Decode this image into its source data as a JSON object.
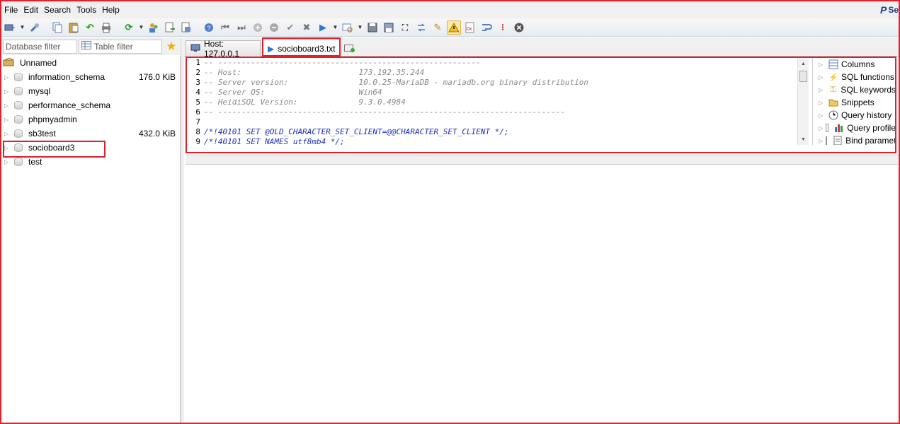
{
  "menu": [
    "File",
    "Edit",
    "Search",
    "Tools",
    "Help"
  ],
  "brand": {
    "mark": "P",
    "text": "Se"
  },
  "toolbar": {
    "icons": [
      "connect-icon",
      "connect-dropdown",
      "plug-icon",
      "copy-icon",
      "paste-icon",
      "undo-icon",
      "print-icon",
      "refresh-icon",
      "refresh-dropdown",
      "users-icon",
      "export-icon",
      "import-icon",
      "help-icon",
      "first-icon",
      "last-icon",
      "add-icon",
      "remove-icon",
      "apply-icon",
      "cancel-icon",
      "run-icon",
      "run-dropdown",
      "query-icon",
      "query-dropdown",
      "save-icon",
      "saveas-icon",
      "binoculars-icon",
      "replace-icon",
      "edit-icon",
      "warning-icon",
      "hex-icon",
      "wrap-icon",
      "stop-icon",
      "close-icon"
    ]
  },
  "filters": {
    "database_filter_placeholder": "Database filter",
    "table_filter_placeholder": "Table filter"
  },
  "tree": {
    "root": "Unnamed",
    "databases": [
      {
        "name": "information_schema",
        "size": "176.0 KiB"
      },
      {
        "name": "mysql",
        "size": ""
      },
      {
        "name": "performance_schema",
        "size": ""
      },
      {
        "name": "phpmyadmin",
        "size": ""
      },
      {
        "name": "sb3test",
        "size": "432.0 KiB"
      },
      {
        "name": "socioboard3",
        "size": ""
      },
      {
        "name": "test",
        "size": ""
      }
    ]
  },
  "tabs": {
    "host": "Host: 127.0.0.1",
    "file": "socioboard3.txt"
  },
  "editor": {
    "lines": [
      {
        "n": "1",
        "text": "-- --------------------------------------------------------",
        "kind": "comment"
      },
      {
        "n": "2",
        "text": "-- Host:                         173.192.35.244",
        "kind": "comment"
      },
      {
        "n": "3",
        "text": "-- Server version:               10.0.25-MariaDB - mariadb.org binary distribution",
        "kind": "comment"
      },
      {
        "n": "4",
        "text": "-- Server OS:                    Win64",
        "kind": "comment"
      },
      {
        "n": "5",
        "text": "-- HeidiSQL Version:             9.3.0.4984",
        "kind": "comment"
      },
      {
        "n": "6",
        "text": "-- --------------------------------------------------------------------------",
        "kind": "comment"
      },
      {
        "n": "7",
        "text": "",
        "kind": "comment"
      },
      {
        "n": "8",
        "text": "/*!40101 SET @OLD_CHARACTER_SET_CLIENT=@@CHARACTER_SET_CLIENT */;",
        "kind": "directive"
      },
      {
        "n": "9",
        "text": "/*!40101 SET NAMES utf8mb4 */;",
        "kind": "directive"
      }
    ]
  },
  "helpers": [
    {
      "label": "Columns",
      "icon": "columns-icon",
      "checkbox": false
    },
    {
      "label": "SQL functions",
      "icon": "lightning-icon",
      "checkbox": false
    },
    {
      "label": "SQL keywords",
      "icon": "key-icon",
      "checkbox": false
    },
    {
      "label": "Snippets",
      "icon": "folder-icon",
      "checkbox": false
    },
    {
      "label": "Query history",
      "icon": "clock-icon",
      "checkbox": false
    },
    {
      "label": "Query profile",
      "icon": "chart-icon",
      "checkbox": true
    },
    {
      "label": "Bind parameters",
      "icon": "bind-icon",
      "checkbox": true
    }
  ],
  "colors": {
    "highlight": "#e0202a",
    "directive": "#1e30b8",
    "comment": "#8a8a8a"
  }
}
